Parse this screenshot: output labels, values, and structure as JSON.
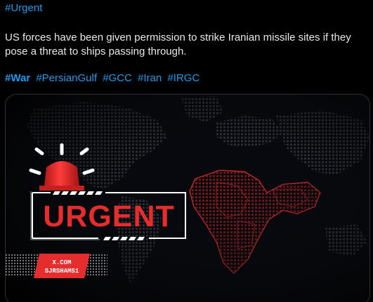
{
  "tweet": {
    "top_hashtag": "#Urgent",
    "body_line1": "US forces have been given permission to strike Iranian missile sites if they",
    "body_line2": "pose a threat to ships passing through.",
    "hashtags": [
      "#War",
      "#PersianGulf",
      "#GCC",
      "#Iran",
      "#IRGC"
    ]
  },
  "media": {
    "headline": "URGENT",
    "watermark_line1": "X.COM",
    "watermark_line2": "SJRSHAMS1"
  },
  "colors": {
    "hashtag": "#1d9bf0",
    "text": "#e7e9ea",
    "background": "#000000",
    "urgent_red": "#e52d2d"
  }
}
